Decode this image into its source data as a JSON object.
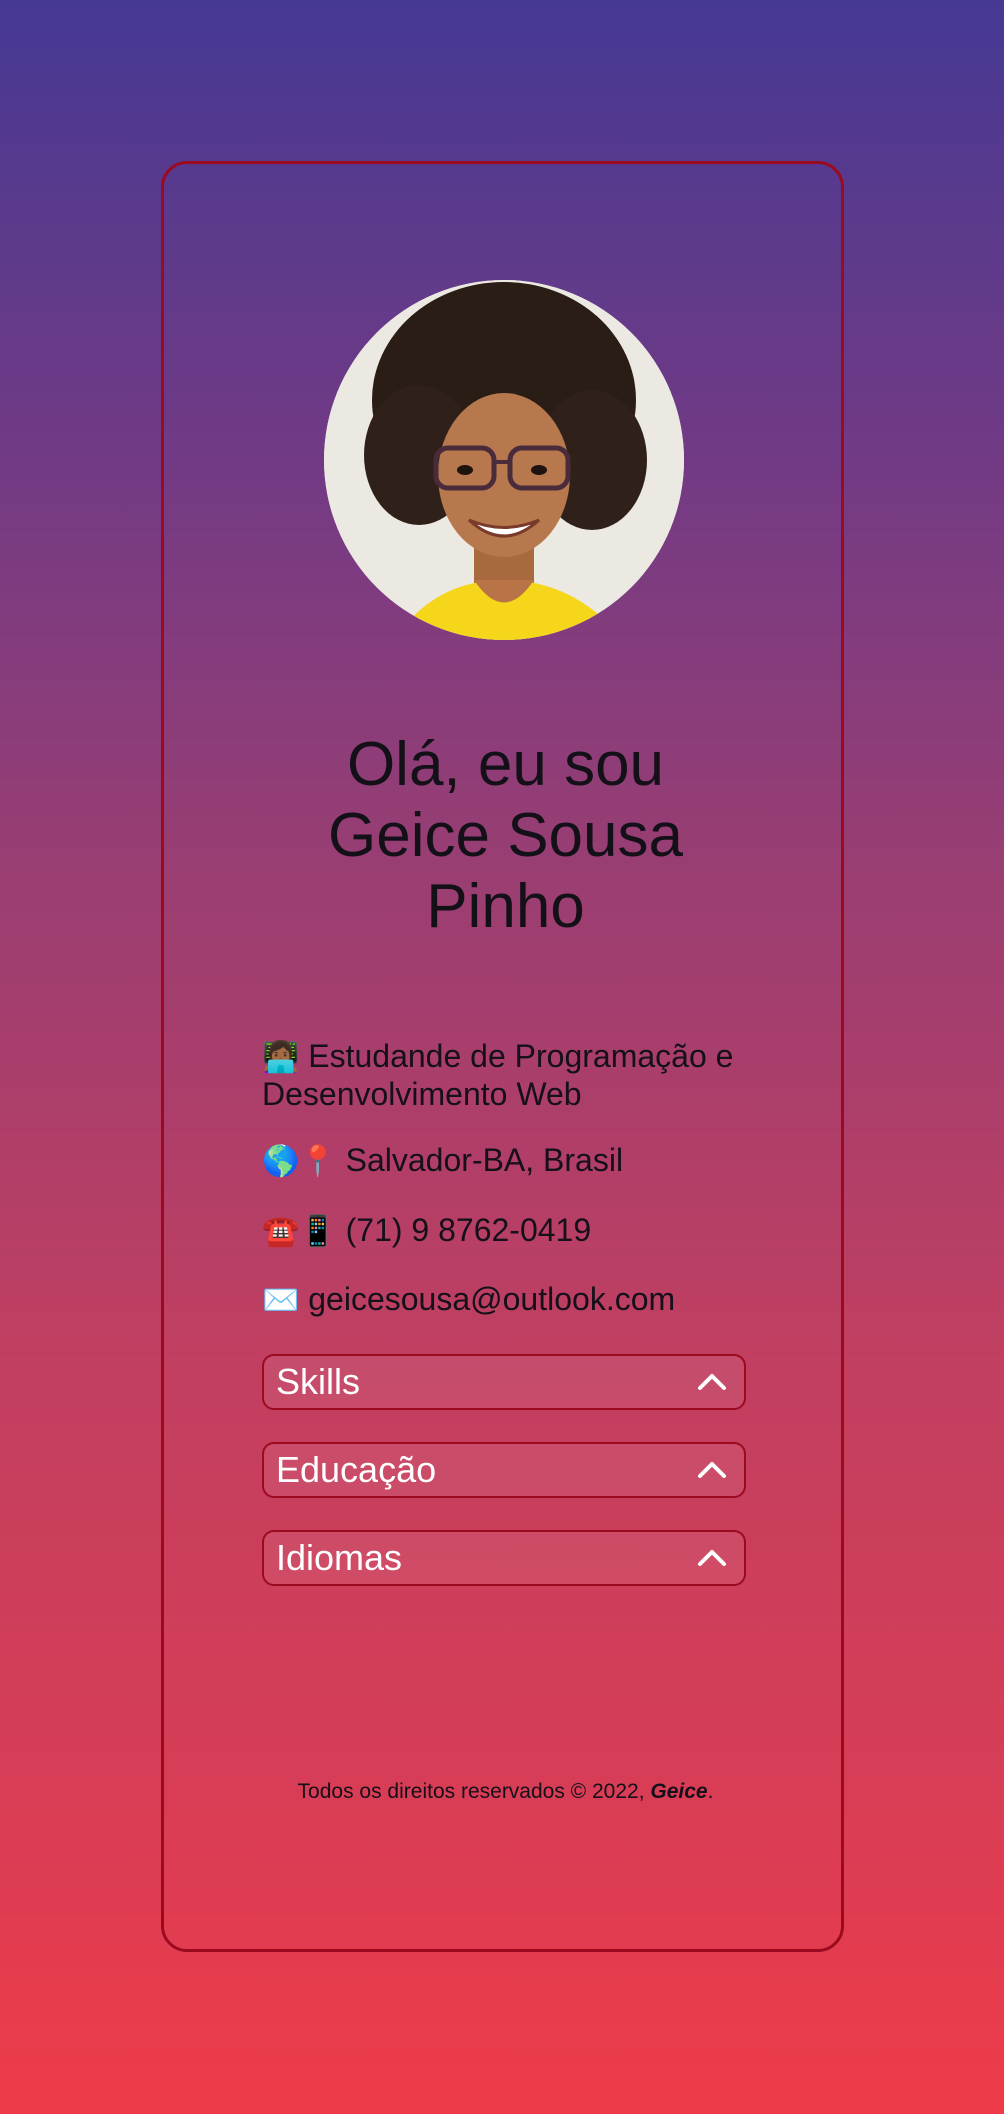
{
  "profile": {
    "greeting_lines": [
      "Olá, eu sou",
      "Geice Sousa",
      "Pinho"
    ]
  },
  "info": {
    "role_emoji": "👩🏾‍💻",
    "role": "Estudande de Programação e Desenvolvimento Web",
    "location_emoji": "🌎📍",
    "location": "Salvador-BA, Brasil",
    "phone_emoji": "☎️📱",
    "phone": "(71) 9 8762-0419",
    "email_emoji": "✉️",
    "email": "geicesousa@outlook.com"
  },
  "accordions": [
    {
      "label": "Skills"
    },
    {
      "label": "Educação"
    },
    {
      "label": "Idiomas"
    }
  ],
  "footer": {
    "text": "Todos os direitos reservados © 2022,",
    "author": "Geice"
  },
  "icons": {
    "accordion_toggle": "chevron-up-icon"
  },
  "colors": {
    "gradient_top": "#463993",
    "gradient_bottom": "#ef3b49",
    "card_border": "#9b0a1e",
    "accordion_label": "#ffffff"
  }
}
